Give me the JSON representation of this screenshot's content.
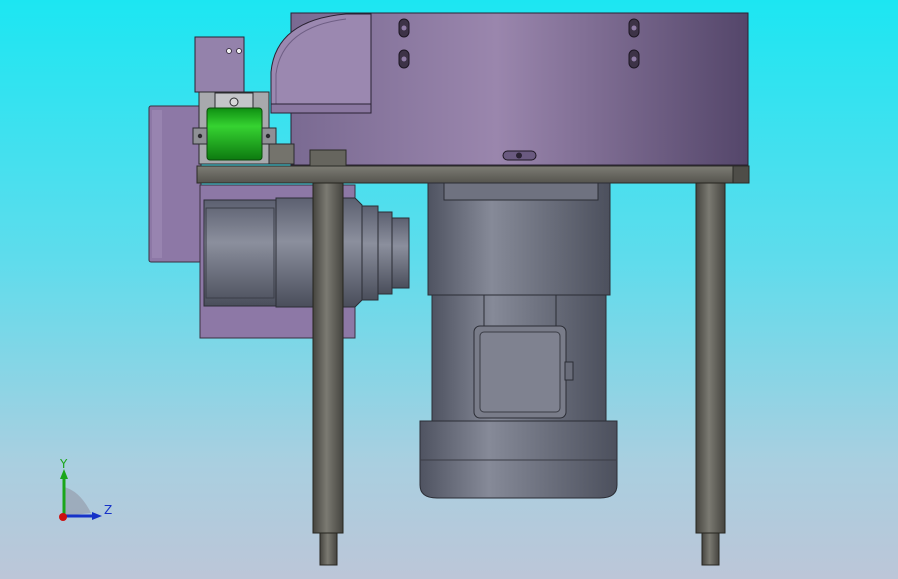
{
  "view": {
    "type": "cad-3d-viewport",
    "background_top": "#1ce6f2",
    "background_bottom": "#bcc6d8"
  },
  "model": {
    "colors": {
      "housing": "#8f7ca6",
      "housing_dark": "#5f4f72",
      "steel": "#6f7382",
      "frame": "#5b5a55",
      "coupling": "#22b81f"
    }
  },
  "triad": {
    "y_label": "Y",
    "z_label": "Z",
    "y_color": "#1aa61a",
    "z_color": "#1632c8",
    "x_color": "#cc1010"
  }
}
